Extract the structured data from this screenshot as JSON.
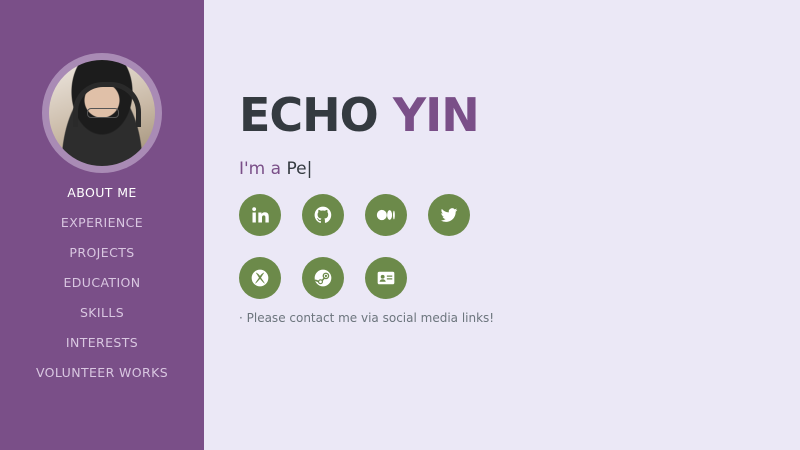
{
  "profile": {
    "avatar_alt": "profile-photo"
  },
  "nav": {
    "items": [
      {
        "label": "ABOUT ME",
        "active": true
      },
      {
        "label": "EXPERIENCE"
      },
      {
        "label": "PROJECTS"
      },
      {
        "label": "EDUCATION"
      },
      {
        "label": "SKILLS"
      },
      {
        "label": "INTERESTS"
      },
      {
        "label": "VOLUNTEER WORKS"
      }
    ]
  },
  "header": {
    "first_name": "ECHO",
    "last_name": "YIN"
  },
  "typed": {
    "prefix": "I'm a ",
    "word": "Pe",
    "cursor": "|"
  },
  "social": {
    "icons": [
      "linkedin-icon",
      "github-icon",
      "medium-icon",
      "twitter-icon",
      "xbox-icon",
      "steam-icon",
      "contact-card-icon"
    ]
  },
  "note": "· Please contact me via social media links!",
  "colors": {
    "sidebar": "#7a4f88",
    "accent": "#7a4f88",
    "button": "#6c8a4a",
    "background": "#ebe8f6",
    "text_dark": "#343a40"
  }
}
